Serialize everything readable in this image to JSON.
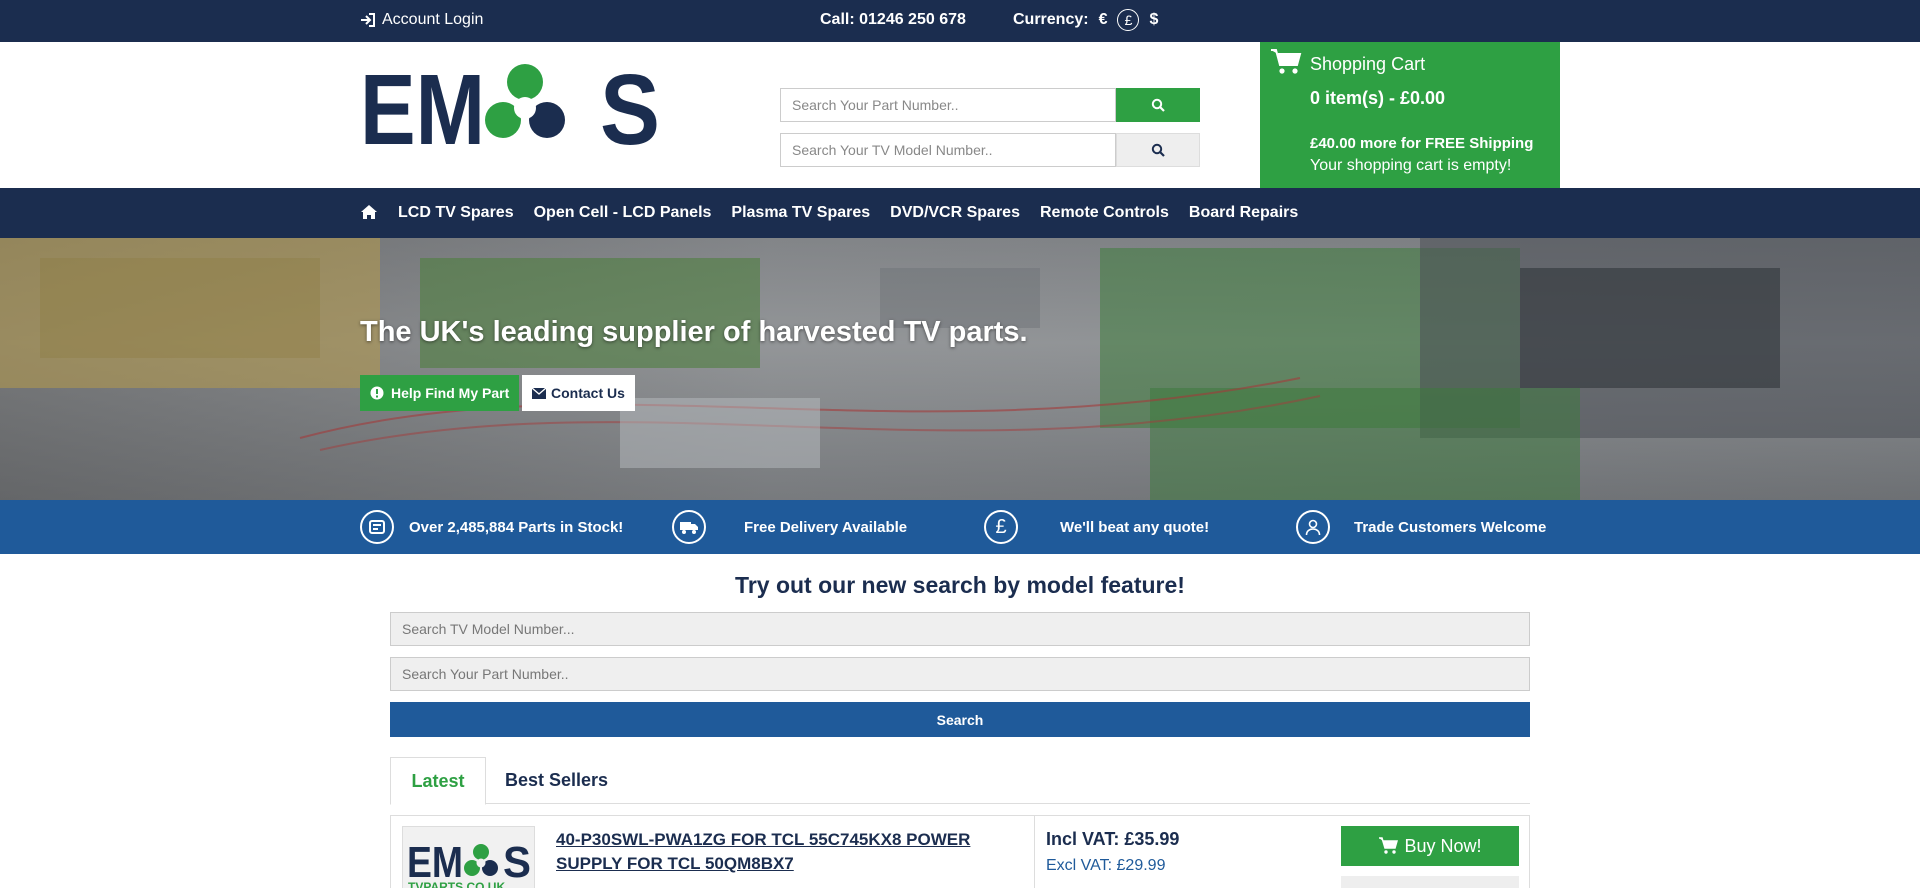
{
  "topbar": {
    "login_label": "Account Login",
    "call_label": "Call: 01246 250 678",
    "currency_label": "Currency:",
    "currencies": [
      "€",
      "£",
      "$"
    ],
    "active_currency": "£"
  },
  "header": {
    "logo_text": "EMOS",
    "search_part_placeholder": "Search Your Part Number..",
    "search_model_placeholder": "Search Your TV Model Number.."
  },
  "cart": {
    "title": "Shopping Cart",
    "count": "0 item(s) - £0.00",
    "shipping": "£40.00 more for FREE Shipping",
    "empty": "Your shopping cart is empty!"
  },
  "nav": {
    "items": [
      "LCD TV Spares",
      "Open Cell - LCD Panels",
      "Plasma TV Spares",
      "DVD/VCR Spares",
      "Remote Controls",
      "Board Repairs"
    ]
  },
  "hero": {
    "title": "The UK's leading supplier of harvested TV parts.",
    "help_label": "Help Find My Part",
    "contact_label": "Contact Us"
  },
  "features": [
    {
      "icon": "stock-icon",
      "label": "Over 2,485,884 Parts in Stock!"
    },
    {
      "icon": "truck-icon",
      "label": "Free Delivery Available"
    },
    {
      "icon": "pound-icon",
      "label": "We'll beat any quote!"
    },
    {
      "icon": "user-icon",
      "label": "Trade Customers Welcome"
    }
  ],
  "model_search": {
    "title": "Try out our new search by model feature!",
    "model_placeholder": "Search TV Model Number...",
    "part_placeholder": "Search Your Part Number..",
    "button_label": "Search"
  },
  "tabs": {
    "active": "Latest",
    "other": "Best Sellers"
  },
  "product": {
    "thumb_logo_text": "EMOS",
    "thumb_site": "TVPARTS.CO.UK",
    "name": "40-P30SWL-PWA1ZG FOR TCL 55C745KX8 POWER SUPPLY FOR TCL 50QM8BX7",
    "incl_vat": "Incl VAT: £35.99",
    "excl_vat": "Excl VAT: £29.99",
    "buy_label": "Buy Now!"
  },
  "colors": {
    "navy": "#1b2d4f",
    "green": "#2ea043",
    "blue": "#1f5a9a"
  }
}
